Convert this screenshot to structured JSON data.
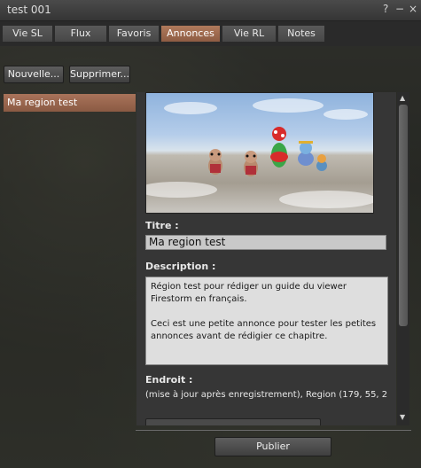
{
  "window": {
    "title": "test 001",
    "help_glyph": "?",
    "minimize_glyph": "−",
    "close_glyph": "×"
  },
  "tabs": [
    {
      "label": "Vie SL",
      "active": false
    },
    {
      "label": "Flux",
      "active": false
    },
    {
      "label": "Favoris",
      "active": false
    },
    {
      "label": "Annonces",
      "active": true
    },
    {
      "label": "Vie RL",
      "active": false
    },
    {
      "label": "Notes",
      "active": false
    }
  ],
  "toolbar": {
    "new_label": "Nouvelle...",
    "delete_label": "Supprimer..."
  },
  "classifieds": [
    {
      "name": "Ma region test",
      "selected": true
    }
  ],
  "detail": {
    "title_label": "Titre :",
    "title_value": "Ma region test",
    "description_label": "Description :",
    "description_paragraphs": [
      "Région test pour rédiger un guide du viewer Firestorm en français.",
      "Ceci est une petite annonce pour tester les petites annonces avant de rédigier ce chapitre."
    ],
    "location_label": "Endroit :",
    "location_value": "(mise à jour après enregistrement), Region  (179, 55, 2"
  },
  "scrollbar": {
    "up_glyph": "▲",
    "down_glyph": "▼"
  },
  "footer": {
    "publish_label": "Publier"
  },
  "colors": {
    "accent": "#a06b52",
    "panel": "#363636",
    "field_bg": "#c9c9c9",
    "textarea_bg": "#dedede"
  },
  "icons": {
    "help": "question-mark-icon",
    "minimize": "minimize-icon",
    "close": "close-icon"
  }
}
